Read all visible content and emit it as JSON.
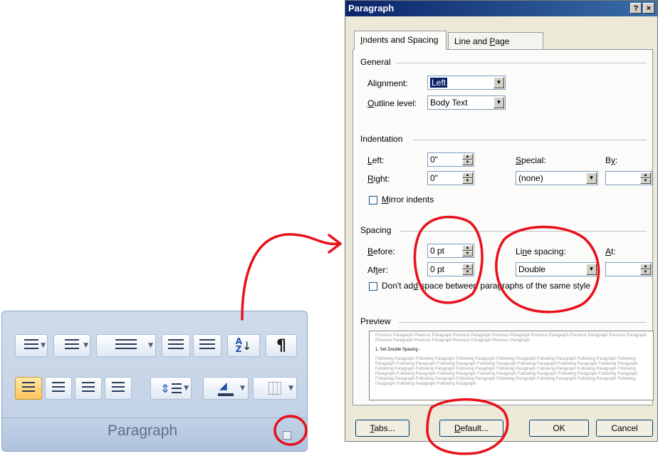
{
  "ribbon": {
    "caption": "Paragraph",
    "icons": [
      "bullets-icon",
      "numbering-icon",
      "multilevel-list-icon",
      "decrease-indent-icon",
      "increase-indent-icon",
      "sort-icon",
      "show-marks-icon",
      "align-left-icon",
      "center-icon",
      "align-right-icon",
      "justify-icon",
      "line-spacing-icon",
      "shading-icon",
      "borders-icon",
      "dialog-launcher-icon"
    ],
    "sort_label": "A\nZ",
    "pilcrow": "¶"
  },
  "dialog": {
    "title": "Paragraph",
    "help": "?",
    "close": "×",
    "tabs": [
      {
        "pre": "",
        "key": "I",
        "post": "ndents and Spacing"
      },
      {
        "pre": "Line and ",
        "key": "P",
        "post": "age Breaks"
      }
    ],
    "general": {
      "title": "General",
      "alignment_pre": "Ali",
      "alignment_key": "g",
      "alignment_post": "nment:",
      "alignment_value": "Left",
      "outline_key": "O",
      "outline_post": "utline level:",
      "outline_value": "Body Text"
    },
    "indentation": {
      "title": "Indentation",
      "left_key": "L",
      "left_post": "eft:",
      "left_value": "0\"",
      "right_key": "R",
      "right_post": "ight:",
      "right_value": "0\"",
      "special_key": "S",
      "special_post": "pecial:",
      "special_value": "(none)",
      "by_pre": "B",
      "by_key": "y",
      "by_post": ":",
      "by_value": "",
      "mirror_key": "M",
      "mirror_post": "irror indents"
    },
    "spacing": {
      "title": "Spacing",
      "before_key": "B",
      "before_post": "efore:",
      "before_value": "0 pt",
      "after_pre": "Af",
      "after_key": "t",
      "after_post": "er:",
      "after_value": "0 pt",
      "line_pre": "Li",
      "line_key": "n",
      "line_post": "e spacing:",
      "line_value": "Double",
      "at_key": "A",
      "at_post": "t:",
      "at_value": "",
      "dont_add_pre": "Don't ad",
      "dont_add_key": "d",
      "dont_add_post": " space between paragraphs of the same style"
    },
    "preview": {
      "title": "Preview",
      "previous": "Previous Paragraph Previous Paragraph Previous Paragraph Previous Paragraph Previous Paragraph Previous Paragraph Previous Paragraph Previous Paragraph Previous Paragraph Previous Paragraph Previous Paragraph",
      "current": "1. Set Double Spacing -",
      "following": "Following Paragraph Following Paragraph Following Paragraph Following Paragraph Following Paragraph Following Paragraph Following Paragraph Following Paragraph Following Paragraph Following Paragraph Following Paragraph Following Paragraph Following Paragraph Following Paragraph Following Paragraph Following Paragraph Following Paragraph Following Paragraph Following Paragraph Following Paragraph Following Paragraph Following Paragraph Following Paragraph Following Paragraph Following Paragraph Following Paragraph Following Paragraph Following Paragraph Following Paragraph Following Paragraph Following Paragraph Following Paragraph Following Paragraph Following Paragraph Following Paragraph"
    },
    "buttons": {
      "tabs_key": "T",
      "tabs_post": "abs...",
      "default_key": "D",
      "default_post": "efault...",
      "ok": "OK",
      "cancel": "Cancel"
    }
  },
  "colors": {
    "annotation": "#e8101a",
    "title_bar": "#0a246a",
    "ribbon": "#c4d3e6"
  }
}
